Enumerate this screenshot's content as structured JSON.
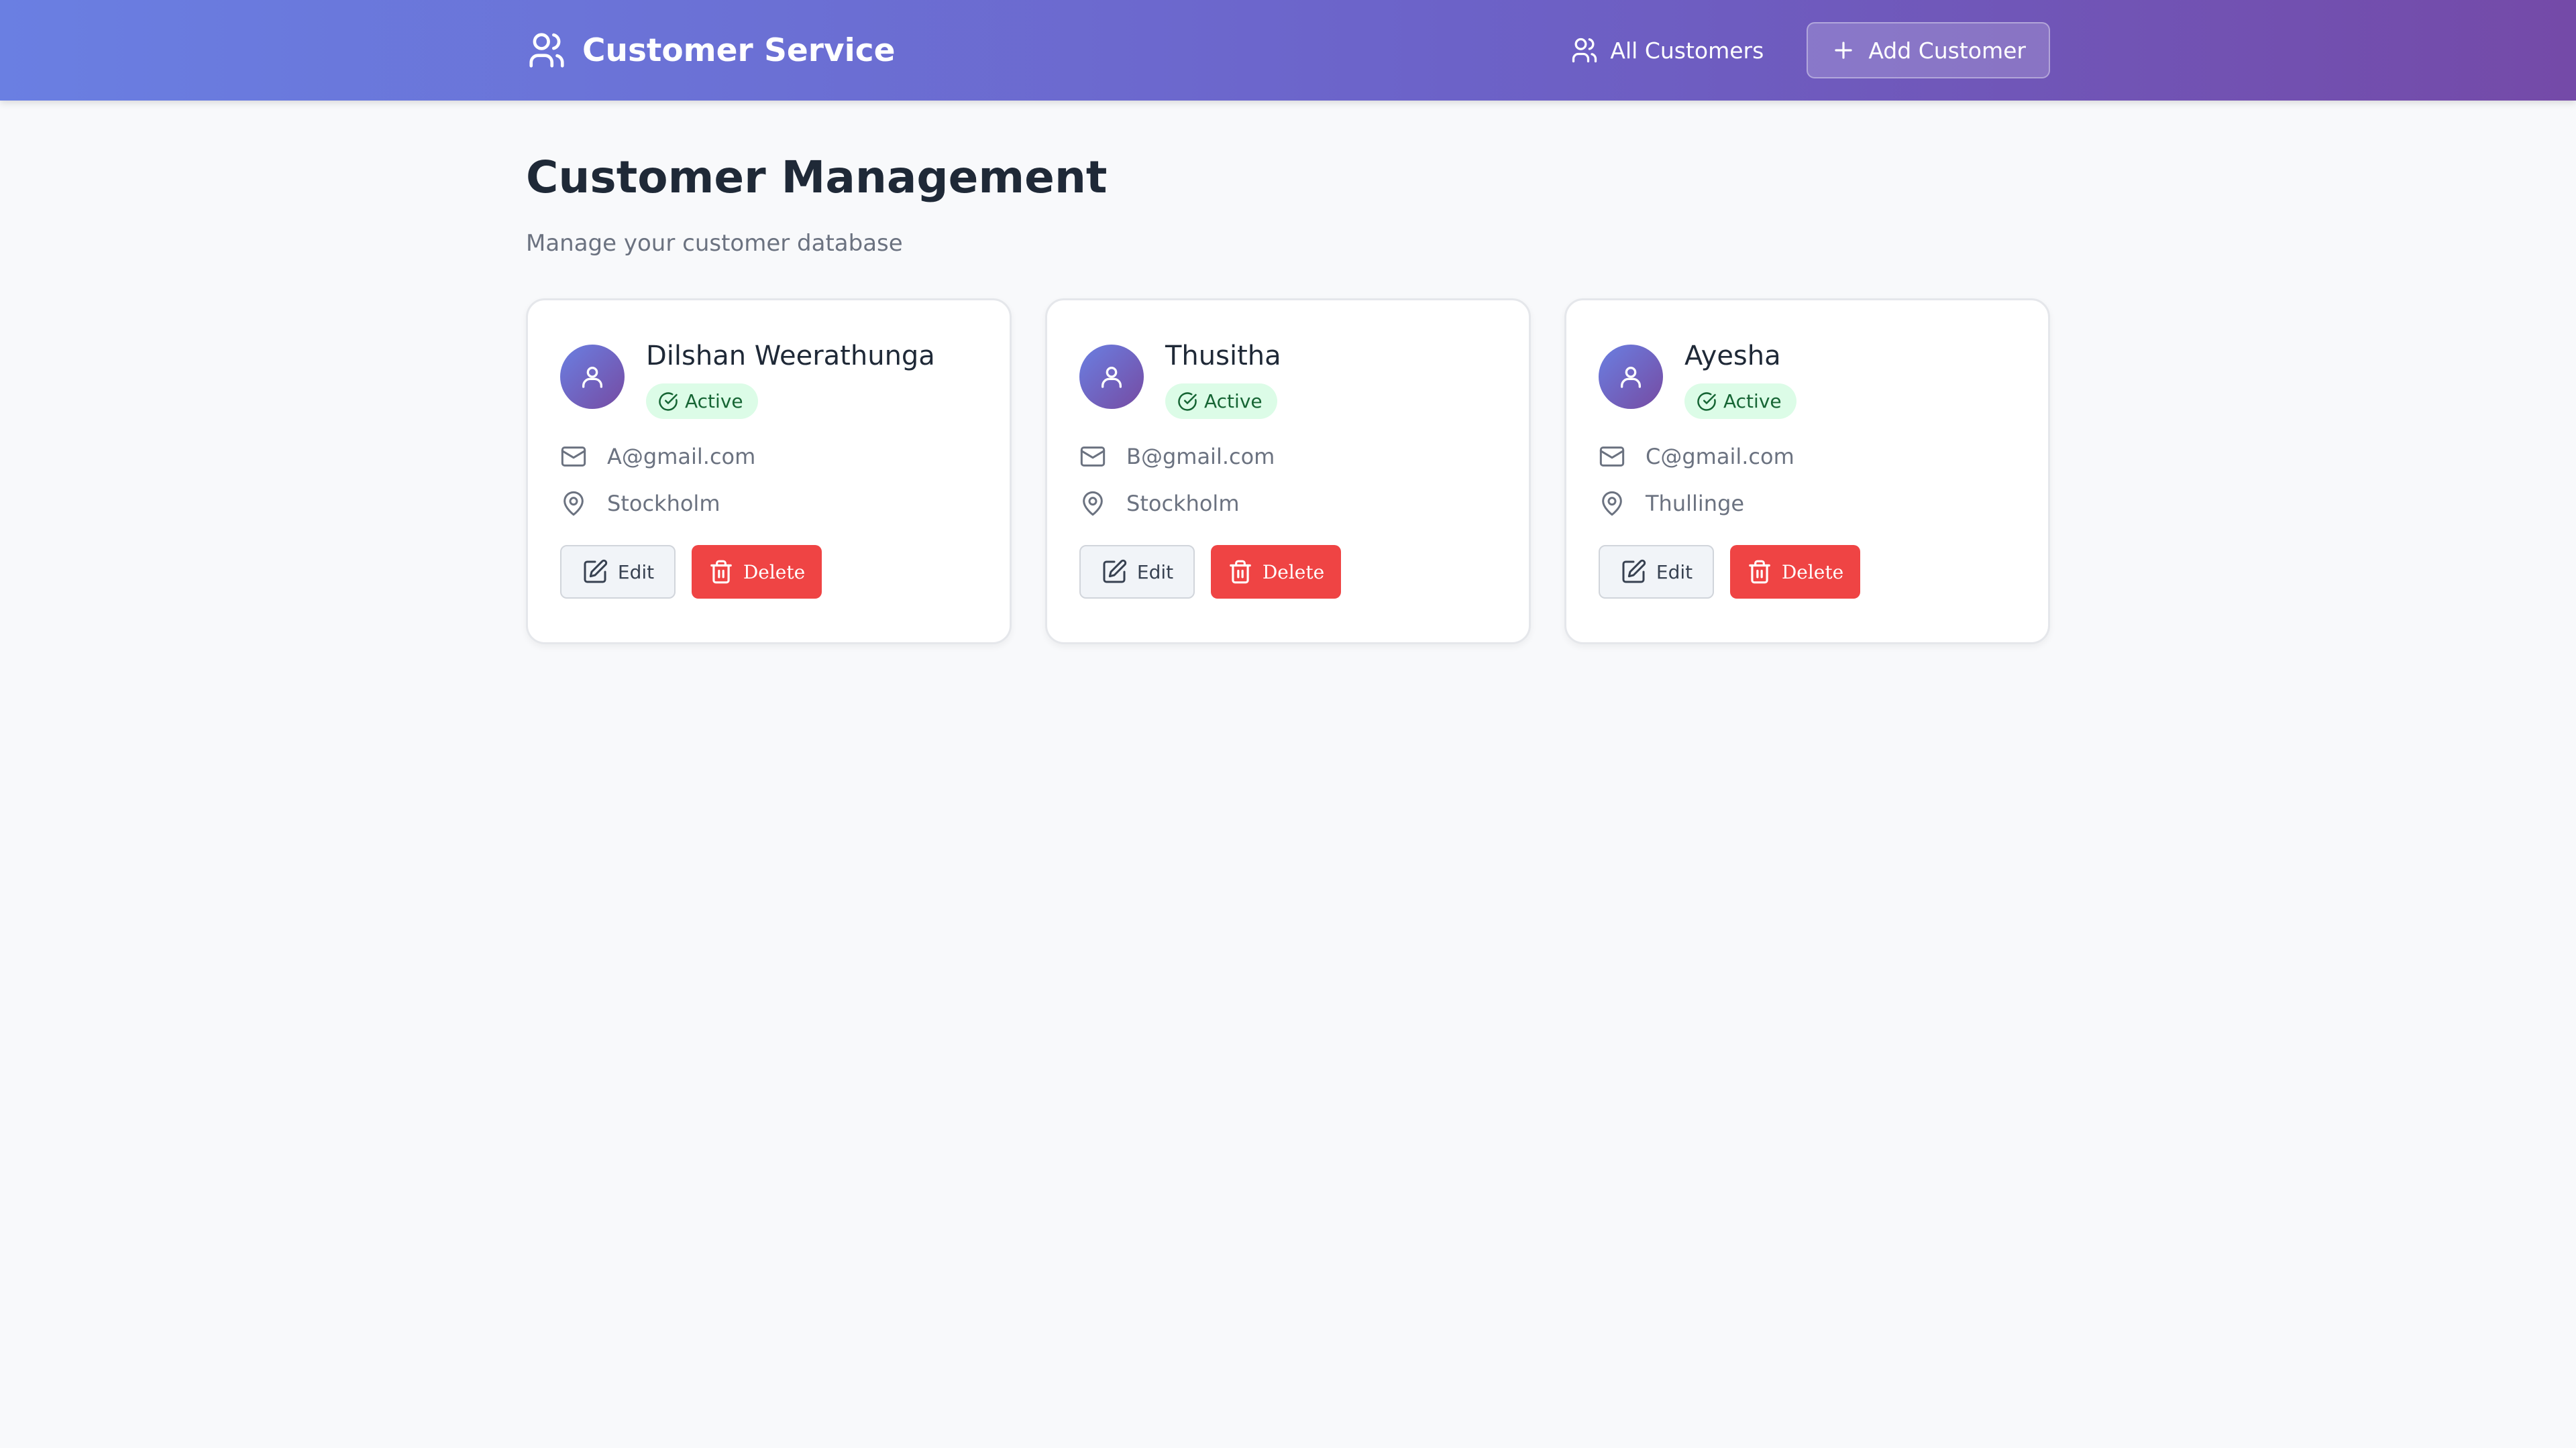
{
  "header": {
    "title": "Customer Service",
    "nav_all_customers": "All Customers",
    "add_customer": "Add Customer"
  },
  "page": {
    "title": "Customer Management",
    "subtitle": "Manage your customer database"
  },
  "customers": [
    {
      "name": "Dilshan Weerathunga",
      "status": "Active",
      "email": "A@gmail.com",
      "location": "Stockholm"
    },
    {
      "name": "Thusitha",
      "status": "Active",
      "email": "B@gmail.com",
      "location": "Stockholm"
    },
    {
      "name": "Ayesha",
      "status": "Active",
      "email": "C@gmail.com",
      "location": "Thullinge"
    }
  ],
  "actions": {
    "edit": "Edit",
    "delete": "Delete"
  },
  "icons": {
    "brand": "users-icon",
    "nav": "users-icon",
    "add": "plus-icon",
    "avatar": "user-icon",
    "status": "check-circle-icon",
    "email": "mail-icon",
    "location": "map-pin-icon",
    "edit": "edit-icon",
    "delete": "trash-icon"
  },
  "colors": {
    "header_gradient_start": "#6a7fe2",
    "header_gradient_end": "#744aa8",
    "status_active_bg": "#dcfce7",
    "status_active_text": "#166534",
    "delete": "#ef4444"
  }
}
